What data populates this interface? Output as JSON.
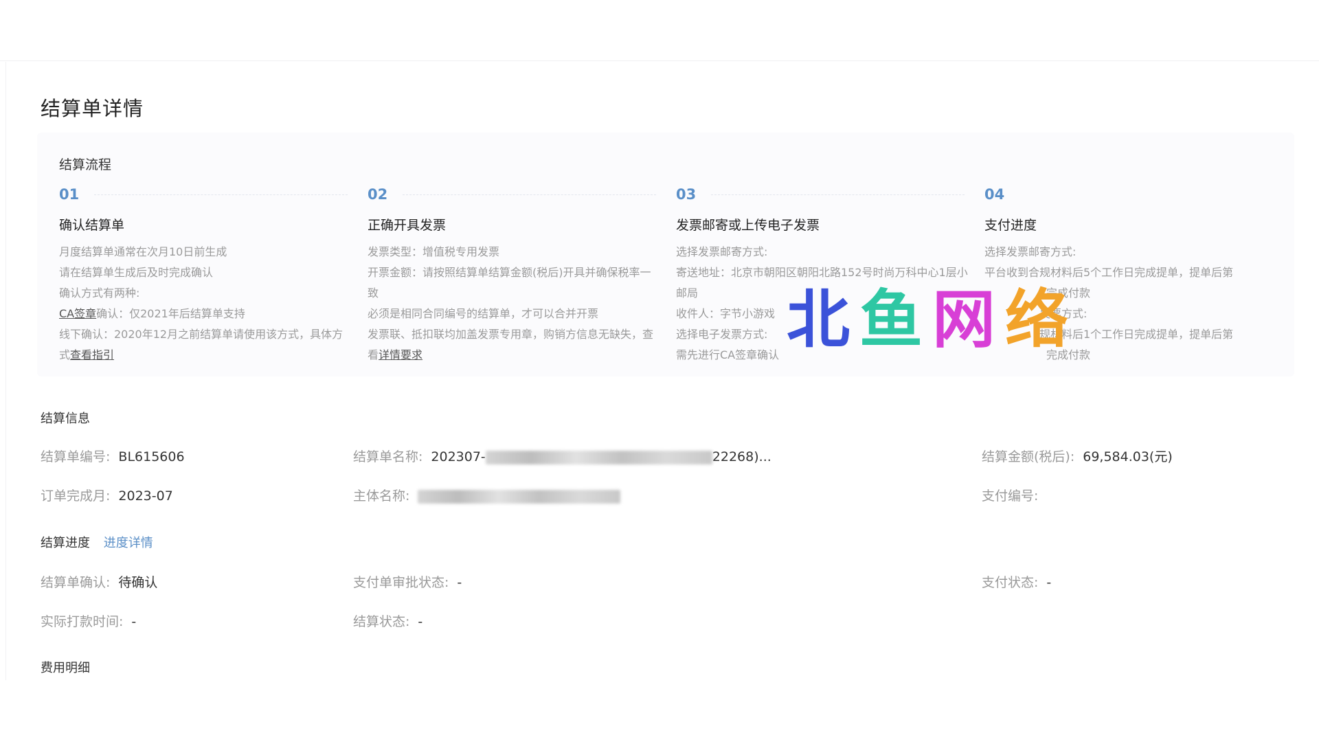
{
  "page": {
    "title": "结算单详情"
  },
  "flow": {
    "title": "结算流程",
    "steps": [
      {
        "num": "01",
        "title": "确认结算单",
        "lines": [
          "月度结算单通常在次月10日前生成",
          "请在结算单生成后及时完成确认",
          "确认方式有两种:"
        ],
        "ca_link": "CA签章",
        "ca_rest": "确认：仅2021年后结算单支持",
        "offline_text": "线下确认：2020年12月之前结算单请使用该方式，具体方式",
        "guide_link": "查看指引"
      },
      {
        "num": "02",
        "title": "正确开具发票",
        "lines": [
          "发票类型：增值税专用发票",
          "开票金额：请按照结算单结算金额(税后)开具并确保税率一致",
          "必须是相同合同编号的结算单，才可以合并开票"
        ],
        "invoice_text": "发票联、抵扣联均加盖发票专用章，购销方信息无缺失，查看",
        "detail_link": "详情要求"
      },
      {
        "num": "03",
        "title": "发票邮寄或上传电子发票",
        "lines": [
          "选择发票邮寄方式:",
          "寄送地址：北京市朝阳区朝阳北路152号时尚万科中心1层小邮局",
          "收件人：字节小游戏",
          "选择电子发票方式:",
          "需先进行CA签章确认"
        ]
      },
      {
        "num": "04",
        "title": "支付进度",
        "lines": [
          "选择发票邮寄方式:",
          "平台收到合规材料后5个工作日完成提单，提单后第",
          "完成付款",
          "发票方式:",
          "规材料后1个工作日完成提单，提单后第",
          "完成付款"
        ]
      }
    ]
  },
  "settlement_info": {
    "title": "结算信息",
    "bill_no_label": "结算单编号:",
    "bill_no": "BL615606",
    "bill_name_label": "结算单名称:",
    "bill_name_prefix": "202307-",
    "bill_name_suffix": "22268)...",
    "amount_label": "结算金额(税后):",
    "amount": "69,584.03(元)",
    "month_label": "订单完成月:",
    "month": "2023-07",
    "entity_label": "主体名称:",
    "pay_no_label": "支付编号:"
  },
  "progress": {
    "title": "结算进度",
    "detail_link": "进度详情",
    "confirm_label": "结算单确认:",
    "confirm_value": "待确认",
    "approval_label": "支付单审批状态:",
    "approval_value": "-",
    "pay_status_label": "支付状态:",
    "pay_status_value": "-",
    "paid_time_label": "实际打款时间:",
    "paid_time_value": "-",
    "settle_status_label": "结算状态:",
    "settle_status_value": "-"
  },
  "fees": {
    "title": "费用明细"
  },
  "watermark": {
    "chars": [
      "北",
      "鱼",
      "网",
      "络"
    ]
  },
  "colors": {
    "accent": "#5b8fc7",
    "label_gray": "#9a9a9a",
    "text_dark": "#333333"
  }
}
